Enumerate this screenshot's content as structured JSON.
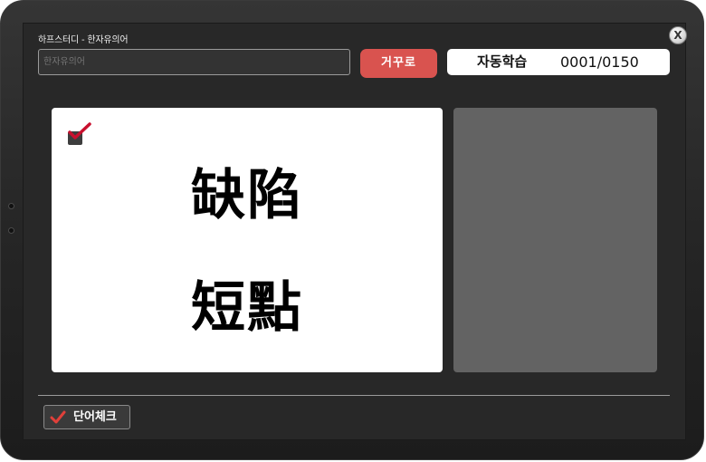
{
  "window": {
    "title": "하프스터디 - 한자유의어",
    "close_label": "X"
  },
  "search": {
    "value": "",
    "placeholder": "한자유의어"
  },
  "toolbar": {
    "reverse_label": "거꾸로",
    "auto_study_label": "자동학습",
    "counter": "0001/0150"
  },
  "card": {
    "word_1": "缺陷",
    "word_2": "短點",
    "checked": true
  },
  "footer": {
    "word_check_label": "단어체크"
  },
  "colors": {
    "accent_red": "#d9534f",
    "search_text": "#e8b870",
    "meaning_panel": "#636363",
    "check_red": "#c8102e"
  },
  "icons": {
    "card_check": "checkmark-icon",
    "footer_check": "checkmark-icon",
    "close": "close-icon"
  }
}
